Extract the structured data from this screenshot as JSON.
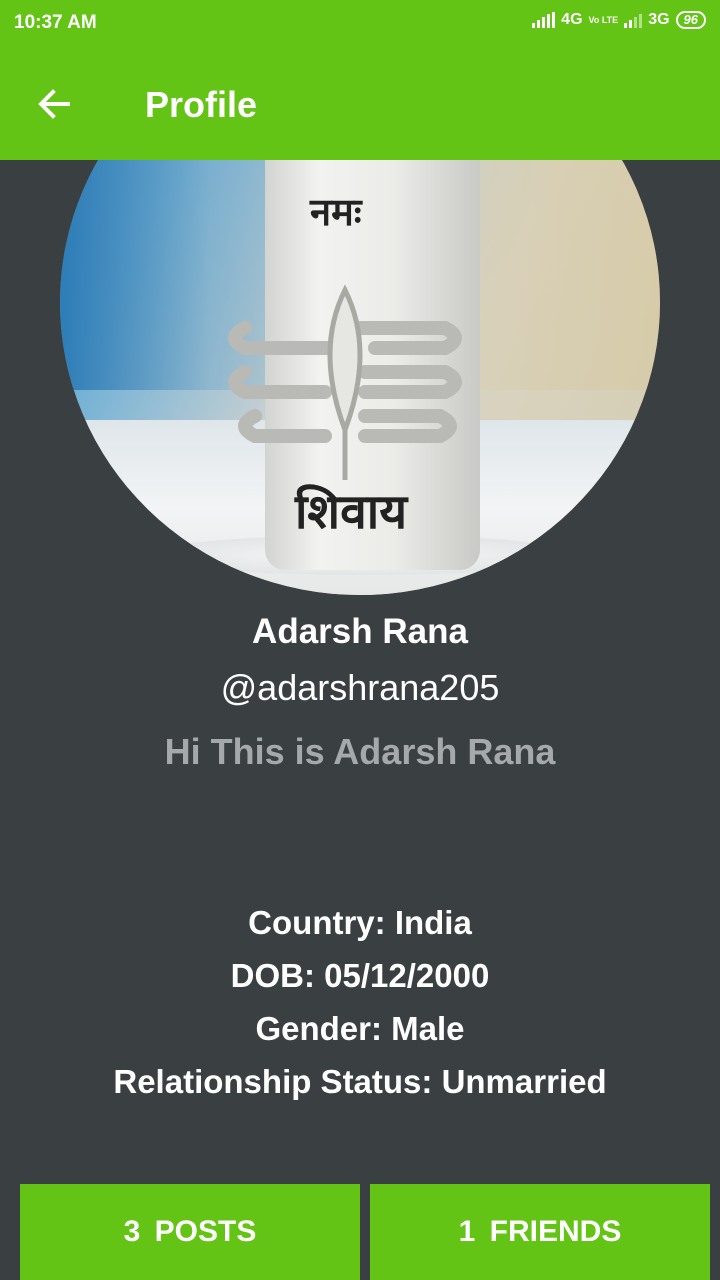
{
  "status_bar": {
    "time": "10:37 AM",
    "network_1": "4G",
    "volte": "Vo LTE",
    "network_2": "3G",
    "battery": "96"
  },
  "app_bar": {
    "title": "Profile",
    "back_icon": "arrow-left-icon"
  },
  "avatar": {
    "text_top": "नमः",
    "text_bottom": "शिवाय"
  },
  "profile": {
    "name": "Adarsh Rana",
    "username": "@adarshrana205",
    "bio": "Hi This is Adarsh Rana"
  },
  "details": {
    "country": "Country: India",
    "dob": "DOB: 05/12/2000",
    "gender": "Gender: Male",
    "relationship": "Relationship Status: Unmarried"
  },
  "stats": {
    "posts_label": "3  POSTS",
    "friends_label": "1  FRIENDS"
  },
  "colors": {
    "accent": "#63c415",
    "background": "#3a3f41",
    "muted_text": "#a5a9ab"
  }
}
